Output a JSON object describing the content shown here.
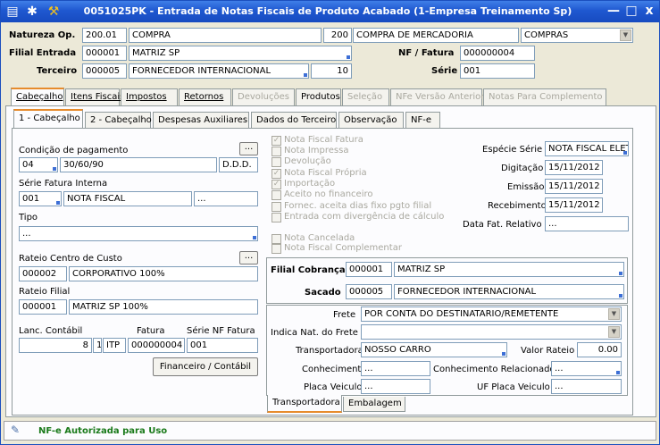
{
  "window": {
    "title": "0051025PK - Entrada de Notas Fiscais de Produto Acabado (1-Empresa Treinamento Sp)",
    "minimize": "—",
    "maximize": "□",
    "close": "x"
  },
  "header": {
    "natureza_label": "Natureza Op.",
    "natureza_code": "200.01",
    "natureza_desc": "COMPRA",
    "natureza_num": "200",
    "natureza_desc2": "COMPRA DE MERCADORIA",
    "natureza_tipo": "COMPRAS",
    "filial_label": "Filial Entrada",
    "filial_code": "000001",
    "filial_desc": "MATRIZ SP",
    "nf_label": "NF / Fatura",
    "nf_value": "000000004",
    "terceiro_label": "Terceiro",
    "terceiro_code": "000005",
    "terceiro_desc": "FORNECEDOR INTERNACIONAL",
    "terceiro_num": "10",
    "serie_label": "Série",
    "serie_value": "001"
  },
  "main_tabs": [
    "Cabeçalho",
    "Itens Fiscais",
    "Impostos",
    "Retornos",
    "Devoluções",
    "Produtos",
    "Seleção",
    "NFe Versão Anterior",
    "Notas Para Complemento"
  ],
  "sub_tabs": [
    "1 - Cabeçalho",
    "2 - Cabeçalho",
    "Despesas Auxiliares",
    "Dados do Terceiro",
    "Observação",
    "NF-e"
  ],
  "left": {
    "condicao_label": "Condição de pagamento",
    "condicao_code": "04",
    "condicao_desc": "30/60/90",
    "condicao_tipo": "D.D.D.",
    "serie_label": "Série Fatura Interna",
    "serie_code": "001",
    "serie_desc": "NOTA FISCAL",
    "serie_extra": "...",
    "tipo_label": "Tipo",
    "tipo_value": "...",
    "rateio_cc_label": "Rateio Centro de Custo",
    "rateio_cc_code": "000002",
    "rateio_cc_desc": "CORPORATIVO 100%",
    "rateio_filial_label": "Rateio Filial",
    "rateio_filial_code": "000001",
    "rateio_filial_desc": "MATRIZ SP 100%",
    "lanc_label": "Lanc. Contábil",
    "fatura_label": "Fatura",
    "serie_nf_label": "Série NF Fatura",
    "lanc_value": "8",
    "lanc_num": "1",
    "lanc_tipo": "ITP",
    "fatura_value": "000000004",
    "serie_nf_value": "001",
    "financeiro_button": "Financeiro / Contábil",
    "ellipsis": "..."
  },
  "checkboxes": [
    {
      "label": "Nota Fiscal Fatura",
      "checked": true
    },
    {
      "label": "Nota Impressa",
      "checked": false
    },
    {
      "label": "Devolução",
      "checked": false
    },
    {
      "label": "Nota Fiscal Própria",
      "checked": true
    },
    {
      "label": "Importação",
      "checked": true
    },
    {
      "label": "Aceito no financeiro",
      "checked": false
    },
    {
      "label": "Fornec. aceita dias fixo pgto filial",
      "checked": false
    },
    {
      "label": "Entrada com divergência de cálculo",
      "checked": false
    },
    {
      "label": "Nota Cancelada",
      "checked": false
    },
    {
      "label": "Nota Fiscal Complementar",
      "checked": false
    }
  ],
  "right": {
    "especie_label": "Espécie Série",
    "especie_value": "NOTA FISCAL ELETR",
    "digitacao_label": "Digitação",
    "digitacao_value": "15/11/2012",
    "emissao_label": "Emissão",
    "emissao_value": "15/11/2012",
    "recebimento_label": "Recebimento",
    "recebimento_value": "15/11/2012",
    "data_fat_label": "Data Fat. Relativo",
    "data_fat_value": "..."
  },
  "cobranca": {
    "filial_label": "Filial Cobrança",
    "filial_code": "000001",
    "filial_desc": "MATRIZ SP",
    "sacado_label": "Sacado",
    "sacado_code": "000005",
    "sacado_desc": "FORNECEDOR INTERNACIONAL"
  },
  "transport": {
    "frete_label": "Frete",
    "frete_value": "POR CONTA DO DESTINATARIO/REMETENTE",
    "indica_label": "Indica Nat. do Frete",
    "indica_value": "",
    "transportadora_label": "Transportadora",
    "transportadora_value": "NOSSO CARRO",
    "valor_rateio_label": "Valor Rateio",
    "valor_rateio_value": "0.00",
    "conhecimento_label": "Conhecimento",
    "conhecimento_value": "...",
    "conhec_rel_label": "Conhecimento Relacionado",
    "conhec_rel_value": "...",
    "placa_label": "Placa Veiculo",
    "placa_value": "...",
    "uf_placa_label": "UF Placa Veiculo",
    "uf_placa_value": "...",
    "tabs": [
      "Transportadora",
      "Embalagem"
    ]
  },
  "status": {
    "text": "NF-e Autorizada para Uso",
    "color": "#1a7a1a"
  }
}
